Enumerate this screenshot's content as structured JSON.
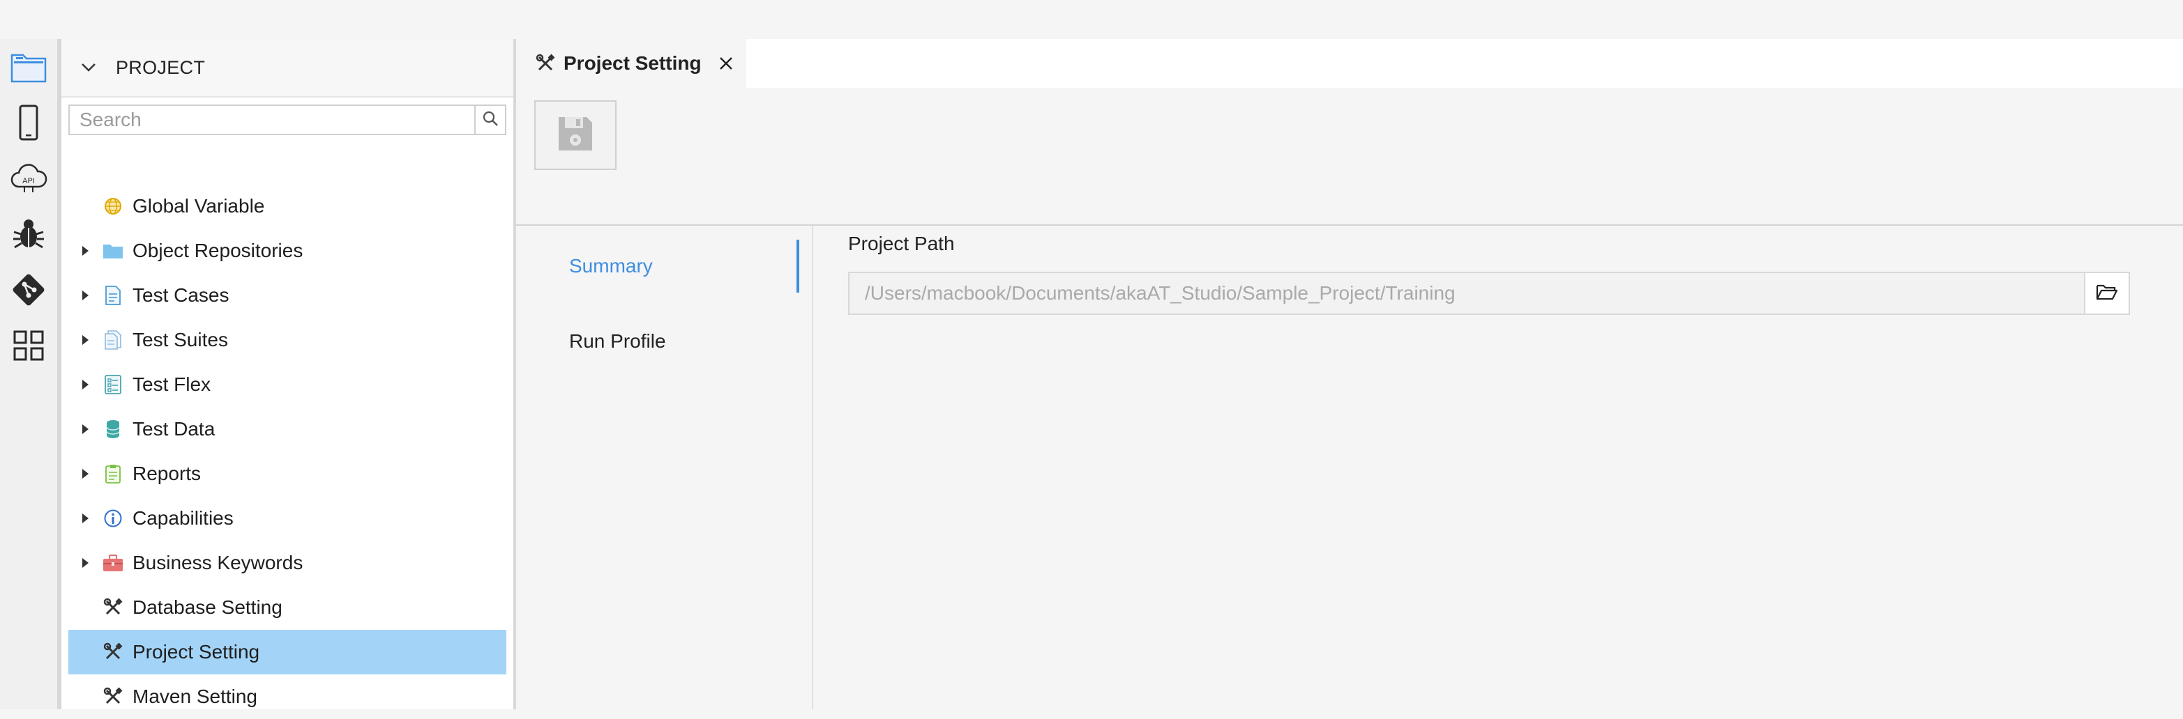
{
  "explorer": {
    "title": "PROJECT",
    "search_placeholder": "Search",
    "items": [
      {
        "label": "Global Variable",
        "icon": "globe-icon",
        "expandable": false
      },
      {
        "label": "Object Repositories",
        "icon": "folder-icon",
        "expandable": true
      },
      {
        "label": "Test Cases",
        "icon": "document-icon",
        "expandable": true
      },
      {
        "label": "Test Suites",
        "icon": "documents-icon",
        "expandable": true
      },
      {
        "label": "Test Flex",
        "icon": "checklist-icon",
        "expandable": true
      },
      {
        "label": "Test Data",
        "icon": "database-icon",
        "expandable": true
      },
      {
        "label": "Reports",
        "icon": "clipboard-icon",
        "expandable": true
      },
      {
        "label": "Capabilities",
        "icon": "info-icon",
        "expandable": true
      },
      {
        "label": "Business Keywords",
        "icon": "briefcase-icon",
        "expandable": true
      },
      {
        "label": "Database Setting",
        "icon": "tools-icon",
        "expandable": false
      },
      {
        "label": "Project Setting",
        "icon": "tools-icon",
        "expandable": false,
        "selected": true
      },
      {
        "label": "Maven Setting",
        "icon": "tools-icon",
        "expandable": false
      }
    ]
  },
  "activity_bar": {
    "icons": [
      "project-explorer-icon",
      "mobile-device-icon",
      "api-cloud-icon",
      "bug-icon",
      "git-icon",
      "grid-apps-icon"
    ],
    "api_text": "API"
  },
  "editor": {
    "tab": {
      "label": "Project Setting",
      "icon": "tools-icon"
    },
    "nav": [
      {
        "label": "Summary",
        "active": true
      },
      {
        "label": "Run Profile",
        "active": false
      }
    ],
    "form": {
      "project_path_label": "Project Path",
      "project_path_value": "/Users/macbook/Documents/akaAT_Studio/Sample_Project/Training"
    }
  },
  "colors": {
    "accent": "#3d8ee0",
    "selection": "#a3d4f8"
  }
}
